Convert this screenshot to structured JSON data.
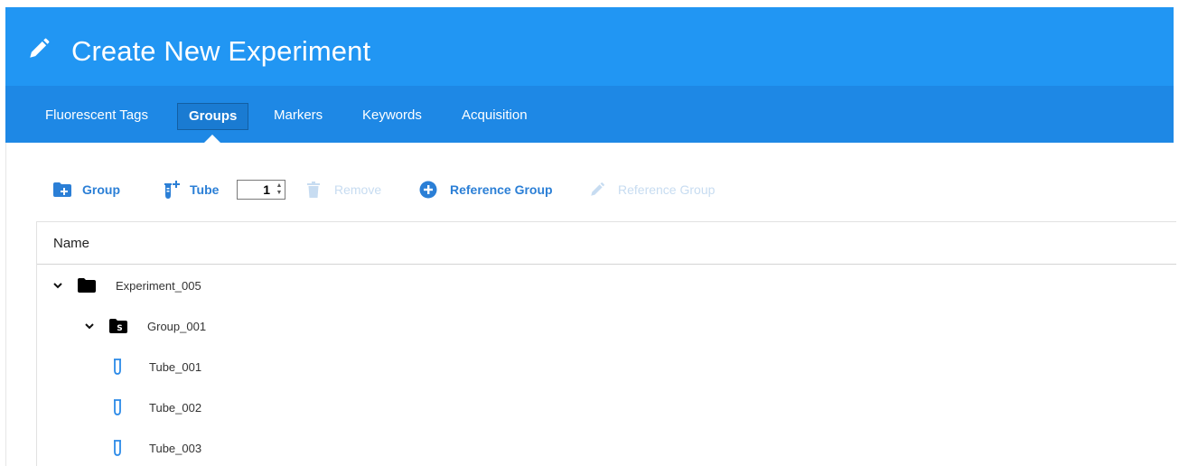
{
  "header": {
    "title": "Create New Experiment",
    "background": "#2196f3"
  },
  "tabs": [
    {
      "label": "Fluorescent Tags",
      "active": false
    },
    {
      "label": "Groups",
      "active": true
    },
    {
      "label": "Markers",
      "active": false
    },
    {
      "label": "Keywords",
      "active": false
    },
    {
      "label": "Acquisition",
      "active": false
    }
  ],
  "toolbar": {
    "group_label": "Group",
    "tube_label": "Tube",
    "tube_count": "1",
    "remove_label": "Remove",
    "reference_group_label": "Reference Group",
    "edit_reference_group_label": "Reference Group",
    "accent": "#2b7fd6",
    "disabled": "#c7dcf1"
  },
  "table": {
    "column_name": "Name",
    "rows": [
      {
        "label": "Experiment_005",
        "type": "experiment",
        "icon": "folder-icon",
        "expanded": true
      },
      {
        "label": "Group_001",
        "type": "group",
        "icon": "group-folder-icon",
        "badge": "S",
        "expanded": true
      },
      {
        "label": "Tube_001",
        "type": "tube",
        "icon": "tube-icon"
      },
      {
        "label": "Tube_002",
        "type": "tube",
        "icon": "tube-icon"
      },
      {
        "label": "Tube_003",
        "type": "tube",
        "icon": "tube-icon"
      }
    ]
  }
}
